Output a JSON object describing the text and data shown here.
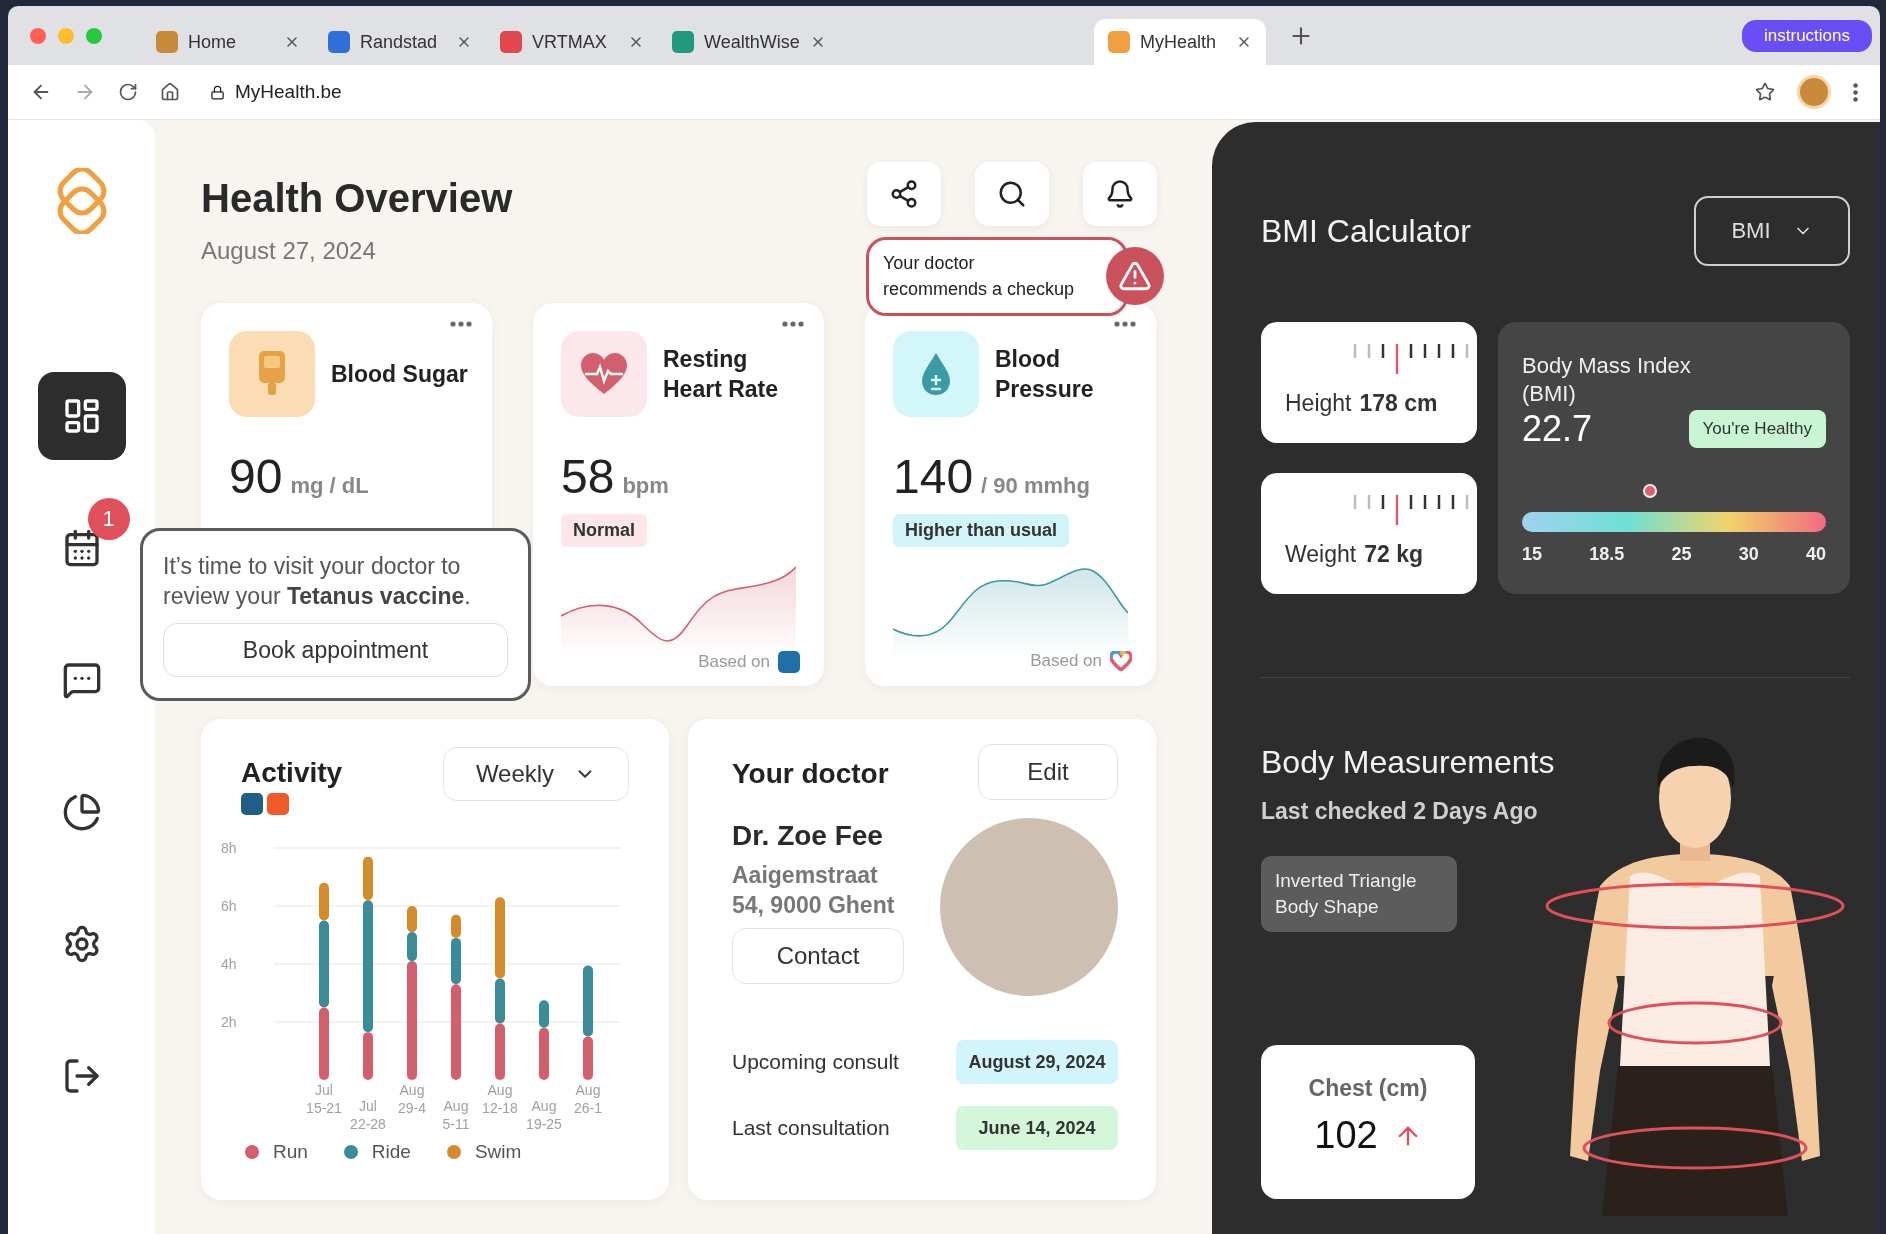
{
  "browser": {
    "tabs": [
      {
        "title": "Home",
        "selected": false,
        "color": "#c98a3c"
      },
      {
        "title": "Randstad",
        "selected": false,
        "color": "#2f6fd6"
      },
      {
        "title": "VRTMAX",
        "selected": false,
        "color": "#e2474b"
      },
      {
        "title": "WealthWise",
        "selected": false,
        "color": "#1f9a7a"
      },
      {
        "title": "MyHealth",
        "selected": true,
        "color": "#f0a040"
      }
    ],
    "address": "MyHealth.be",
    "instructions": "instructions"
  },
  "sidebar": {
    "items": [
      {
        "kind": "dashboard",
        "selected": true
      },
      {
        "kind": "calendar",
        "selected": false,
        "badge": "1"
      },
      {
        "kind": "chat",
        "selected": false
      },
      {
        "kind": "pie",
        "selected": false
      },
      {
        "kind": "settings",
        "selected": false
      },
      {
        "kind": "logout",
        "selected": false
      }
    ]
  },
  "header": {
    "title": "Health Overview",
    "date": "August 27, 2024"
  },
  "alert": {
    "text": "Your doctor recommends a checkup"
  },
  "metrics": [
    {
      "kind": "glucose",
      "title": "Blood Sugar",
      "value": "90",
      "unit": "mg / dL"
    },
    {
      "kind": "heart",
      "title": "Resting Heart Rate",
      "value": "58",
      "unit": "bpm",
      "tag": "Normal",
      "source": "Based on"
    },
    {
      "kind": "pressure",
      "title": "Blood Pressure",
      "value": "140",
      "unit": "/ 90 mmhg",
      "tag": "Higher than usual",
      "source": "Based on"
    }
  ],
  "reminder": {
    "text": "It’s time to visit your doctor to review your **Tetanus vaccine**.",
    "button": "Book appointment"
  },
  "activity": {
    "title": "Activity",
    "period": "Weekly",
    "chart_data": {
      "type": "bar",
      "stacked": true,
      "categories": [
        "Jul 15-21",
        "Jul 22-28",
        "Aug 29-4",
        "Aug 5-11",
        "Aug 12-18",
        "Aug 19-25",
        "Aug 26-1"
      ],
      "series": [
        {
          "name": "Run",
          "color": "#d2606c",
          "values": [
            2.5,
            1.65,
            4.1,
            3.3,
            1.95,
            1.8,
            1.5
          ]
        },
        {
          "name": "Ride",
          "color": "#3b8b98",
          "values": [
            3.0,
            4.55,
            1.0,
            1.6,
            1.55,
            0.95,
            2.45
          ]
        },
        {
          "name": "Swim",
          "color": "#d48b2c",
          "values": [
            1.3,
            1.5,
            0.9,
            0.8,
            2.8,
            null,
            null
          ]
        }
      ],
      "ylim": [
        0,
        8
      ],
      "grid": true,
      "yticks": [
        {
          "value": 2,
          "label": "2h"
        },
        {
          "value": 4,
          "label": "4h"
        },
        {
          "value": 6,
          "label": "6h"
        },
        {
          "value": 8,
          "label": "8h"
        }
      ]
    }
  },
  "doctor": {
    "heading": "Your doctor",
    "edit": "Edit",
    "name": "Dr. Zoe Fee",
    "address": "Aaigemstraat 54, 9000 Ghent",
    "contact": "Contact",
    "consults": [
      {
        "label": "Upcoming consult",
        "date": "August 29, 2024",
        "color": "#d2f5fb"
      },
      {
        "label": "Last consultation",
        "date": "June 14, 2024",
        "color": "#d4f7dc"
      }
    ]
  },
  "bmi": {
    "title": "BMI Calculator",
    "selector": "BMI",
    "measures": [
      {
        "label": "Height",
        "value": "178 cm"
      },
      {
        "label": "Weight",
        "value": "72 kg"
      }
    ],
    "index": {
      "label": "Body Mass Index (BMI)",
      "value": "22.7",
      "status": "You're Healthy",
      "level": 0.42,
      "scale": [
        "15",
        "18.5",
        "25",
        "30",
        "40"
      ]
    }
  },
  "body": {
    "title": "Body Measurements",
    "subtitle": "Last checked 2 Days Ago",
    "shape": "Inverted Triangle Body Shape",
    "chest": {
      "label": "Chest (cm)",
      "value": "102"
    }
  }
}
